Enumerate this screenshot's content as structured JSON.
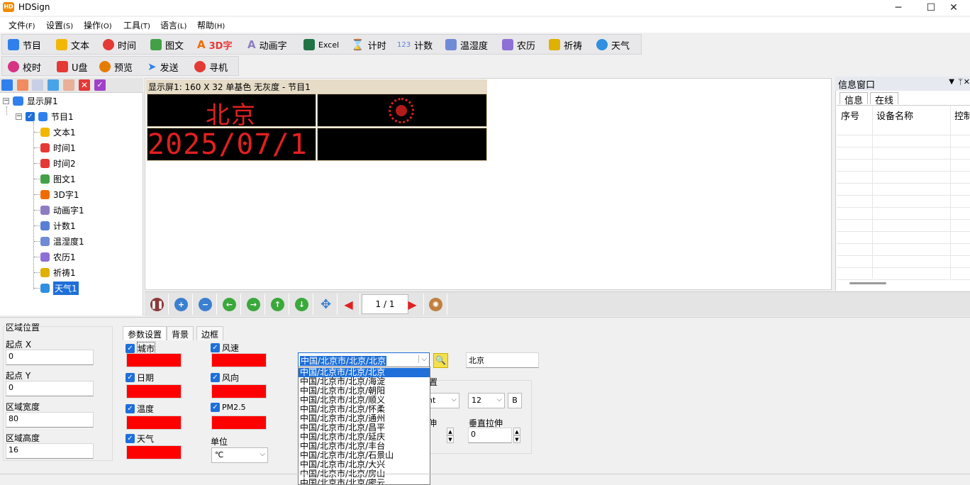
{
  "app": {
    "title": "HDSign"
  },
  "menu": [
    {
      "label": "文件",
      "acc": "(F)"
    },
    {
      "label": "设置",
      "acc": "(S)"
    },
    {
      "label": "操作",
      "acc": "(O)"
    },
    {
      "label": "工具",
      "acc": "(T)"
    },
    {
      "label": "语言",
      "acc": "(L)"
    },
    {
      "label": "帮助",
      "acc": "(H)"
    }
  ],
  "toolbar1": [
    {
      "label": "节目",
      "icon": "program-icon",
      "color": "#2f80ed"
    },
    {
      "label": "文本",
      "icon": "text-icon",
      "color": "#f2b705"
    },
    {
      "label": "时间",
      "icon": "clock-icon",
      "color": "#e53935"
    },
    {
      "label": "图文",
      "icon": "image-icon",
      "color": "#43a047"
    },
    {
      "label": "3D字",
      "icon": "3d-text-icon",
      "color": "#ef6c00"
    },
    {
      "label": "动画字",
      "icon": "animated-text-icon",
      "color": "#8e7cc3"
    },
    {
      "label": "Excel",
      "icon": "excel-icon",
      "color": "#217346"
    },
    {
      "label": "计时",
      "icon": "hourglass-icon",
      "color": "#b04fc4"
    },
    {
      "label": "计数",
      "icon": "counter-icon",
      "color": "#5b7fd6"
    },
    {
      "label": "温湿度",
      "icon": "thermometer-icon",
      "color": "#6f8bd6"
    },
    {
      "label": "农历",
      "icon": "calendar-icon",
      "color": "#8e6fd6"
    },
    {
      "label": "祈祷",
      "icon": "prayer-icon",
      "color": "#e0b000"
    },
    {
      "label": "天气",
      "icon": "weather-icon",
      "color": "#2f8fe0"
    }
  ],
  "toolbar2": [
    {
      "label": "校时",
      "icon": "sync-time-icon",
      "color": "#d63384"
    },
    {
      "label": "U盘",
      "icon": "usb-icon",
      "color": "#e53935"
    },
    {
      "label": "预览",
      "icon": "preview-icon",
      "color": "#e57c00"
    },
    {
      "label": "发送",
      "icon": "send-icon",
      "color": "#2f80ed"
    },
    {
      "label": "寻机",
      "icon": "search-device-icon",
      "color": "#e53935"
    }
  ],
  "tree": {
    "root": "显示屏1",
    "program": "节目1",
    "items": [
      {
        "label": "文本1",
        "icon": "text-icon",
        "color": "#f2b705"
      },
      {
        "label": "时间1",
        "icon": "clock-icon",
        "color": "#e53935"
      },
      {
        "label": "时间2",
        "icon": "clock-icon",
        "color": "#e53935"
      },
      {
        "label": "图文1",
        "icon": "image-icon",
        "color": "#43a047"
      },
      {
        "label": "3D字1",
        "icon": "3d-text-icon",
        "color": "#ef6c00"
      },
      {
        "label": "动画字1",
        "icon": "animated-text-icon",
        "color": "#8e7cc3"
      },
      {
        "label": "计数1",
        "icon": "counter-icon",
        "color": "#5b7fd6"
      },
      {
        "label": "温湿度1",
        "icon": "thermometer-icon",
        "color": "#6f8bd6"
      },
      {
        "label": "农历1",
        "icon": "calendar-icon",
        "color": "#8e6fd6"
      },
      {
        "label": "祈祷1",
        "icon": "prayer-icon",
        "color": "#e0b000"
      },
      {
        "label": "天气1",
        "icon": "weather-icon",
        "color": "#2f8fe0"
      }
    ]
  },
  "screen": {
    "header": "显示屏1: 160 X 32  单基色 无灰度 - 节目1",
    "cell_city": "北京",
    "cell_date": "2025/07/1",
    "led_color": "#e02020"
  },
  "nav": {
    "page": "1 / 1"
  },
  "info": {
    "title": "信息窗口",
    "tabs": [
      "信息",
      "在线"
    ],
    "columns": [
      "序号",
      "设备名称",
      "控制"
    ]
  },
  "region": {
    "title": "区域位置",
    "x_label": "起点 X",
    "x_value": "0",
    "y_label": "起点 Y",
    "y_value": "0",
    "w_label": "区域宽度",
    "w_value": "80",
    "h_label": "区域高度",
    "h_value": "16"
  },
  "params": {
    "tabs": [
      "参数设置",
      "背景",
      "边框"
    ],
    "checks_left": [
      "城市",
      "日期",
      "温度",
      "天气"
    ],
    "checks_right": [
      "风速",
      "风向",
      "PM2.5"
    ],
    "unit_label": "单位",
    "unit_value": "℃",
    "city_select": "中国/北京市/北京/北京",
    "city_text": "北京",
    "partial_label": "置",
    "partial_font": "nt",
    "font_size": "12",
    "bold_label": "B",
    "h_stretch_label": "伸",
    "v_stretch_label": "垂直拉伸",
    "v_stretch_value": "0"
  },
  "dropdown": [
    "中国/北京市/北京/北京",
    "中国/北京市/北京/海淀",
    "中国/北京市/北京/朝阳",
    "中国/北京市/北京/顺义",
    "中国/北京市/北京/怀柔",
    "中国/北京市/北京/通州",
    "中国/北京市/北京/昌平",
    "中国/北京市/北京/延庆",
    "中国/北京市/北京/丰台",
    "中国/北京市/北京/石景山",
    "中国/北京市/北京/大兴",
    "中国/北京市/北京/房山",
    "中国/北京市/北京/密云"
  ]
}
